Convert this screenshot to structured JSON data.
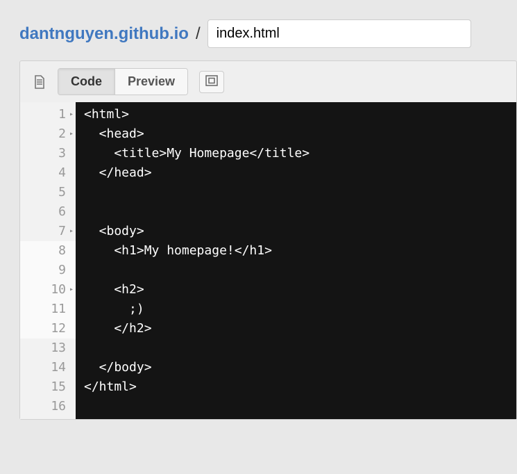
{
  "header": {
    "repo": "dantnguyen.github.io",
    "separator": "/",
    "filename": "index.html"
  },
  "toolbar": {
    "tabs": {
      "code": "Code",
      "preview": "Preview"
    }
  },
  "editor": {
    "lines": [
      {
        "n": "1",
        "fold": true,
        "hl": false,
        "text": "<html>"
      },
      {
        "n": "2",
        "fold": true,
        "hl": false,
        "text": "  <head>"
      },
      {
        "n": "3",
        "fold": false,
        "hl": false,
        "text": "    <title>My Homepage</title>"
      },
      {
        "n": "4",
        "fold": false,
        "hl": false,
        "text": "  </head>"
      },
      {
        "n": "5",
        "fold": false,
        "hl": false,
        "text": "  "
      },
      {
        "n": "6",
        "fold": false,
        "hl": false,
        "text": "  "
      },
      {
        "n": "7",
        "fold": true,
        "hl": false,
        "text": "  <body>"
      },
      {
        "n": "8",
        "fold": false,
        "hl": true,
        "text": "    <h1>My homepage!</h1>"
      },
      {
        "n": "9",
        "fold": false,
        "hl": true,
        "text": "    "
      },
      {
        "n": "10",
        "fold": true,
        "hl": true,
        "text": "    <h2>"
      },
      {
        "n": "11",
        "fold": false,
        "hl": true,
        "text": "      ;)"
      },
      {
        "n": "12",
        "fold": false,
        "hl": true,
        "text": "    </h2>"
      },
      {
        "n": "13",
        "fold": false,
        "hl": false,
        "text": "    "
      },
      {
        "n": "14",
        "fold": false,
        "hl": false,
        "text": "  </body>"
      },
      {
        "n": "15",
        "fold": false,
        "hl": false,
        "text": "</html>"
      },
      {
        "n": "16",
        "fold": false,
        "hl": false,
        "text": ""
      }
    ]
  }
}
